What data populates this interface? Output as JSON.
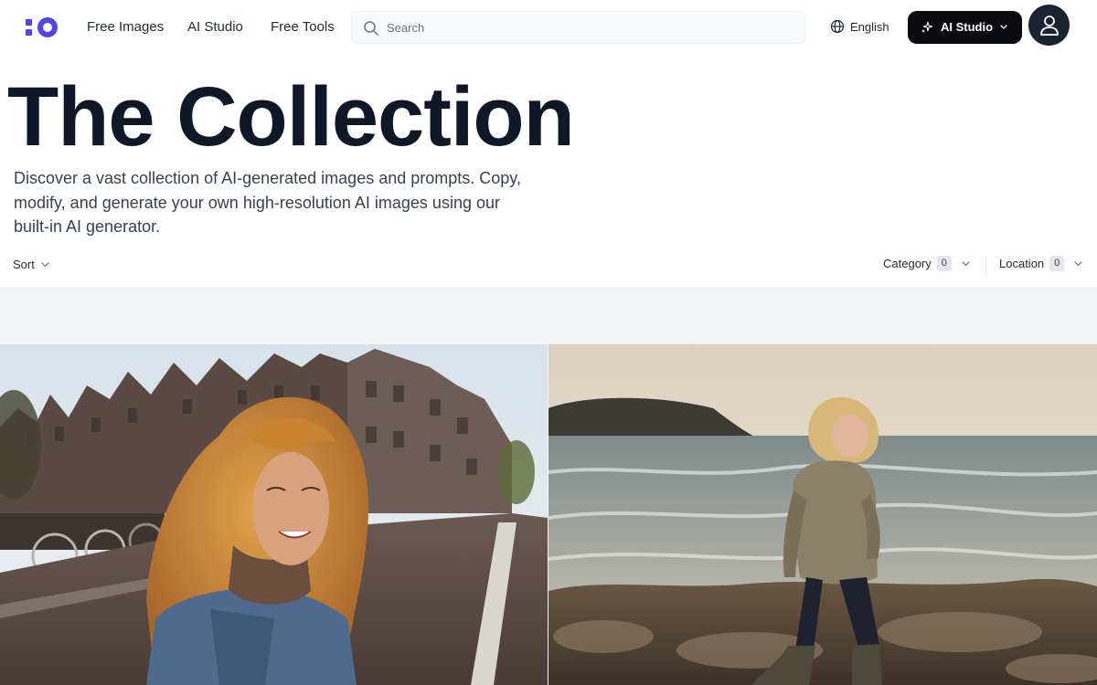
{
  "header": {
    "nav": [
      "Free Images",
      "AI Studio",
      "Free Tools"
    ],
    "search_placeholder": "Search",
    "language": "English",
    "ai_studio_button": "AI Studio"
  },
  "hero": {
    "title": "The Collection",
    "subtitle": "Discover a vast collection of AI-generated images and prompts. Copy, modify, and generate your own high-resolution AI images using our built-in AI generator."
  },
  "filters": {
    "sort_label": "Sort",
    "category_label": "Category",
    "category_count": "0",
    "location_label": "Location",
    "location_count": "0"
  },
  "colors": {
    "brand": "#4f46e5",
    "ai_button": "#0b0b12",
    "avatar": "#1a2332",
    "title": "#101727"
  }
}
